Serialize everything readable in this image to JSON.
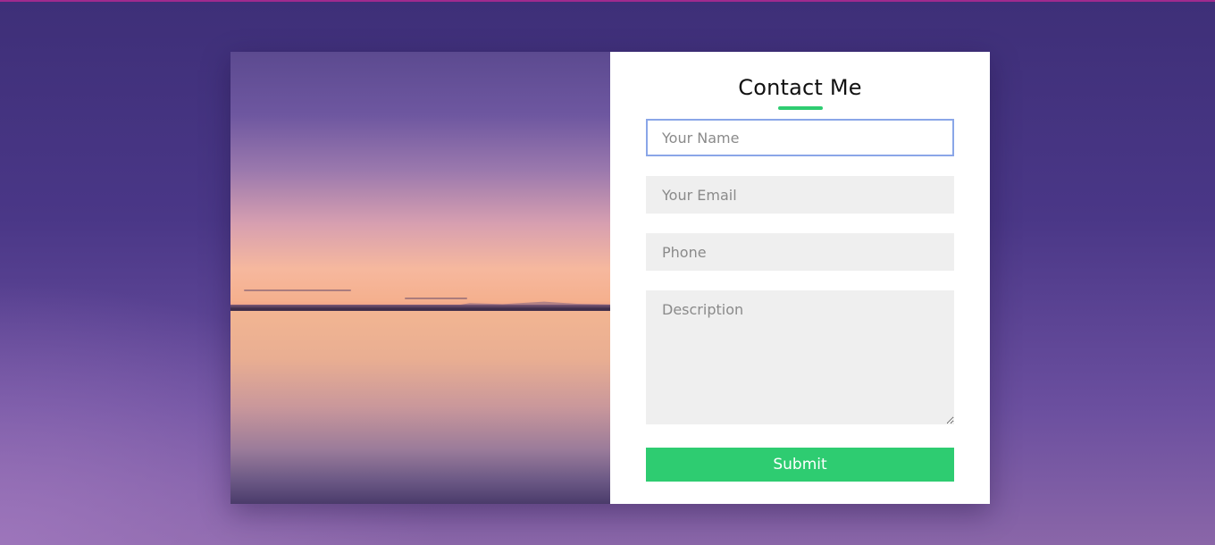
{
  "colors": {
    "accent": "#2ecc71",
    "focus_border": "#8aa6e8",
    "input_background": "#efefef",
    "card_background": "#ffffff"
  },
  "image": {
    "subject": "sunset-over-lake-photo"
  },
  "form": {
    "title": "Contact Me",
    "name_placeholder": "Your Name",
    "email_placeholder": "Your Email",
    "phone_placeholder": "Phone",
    "description_placeholder": "Description",
    "submit_label": "Submit"
  }
}
